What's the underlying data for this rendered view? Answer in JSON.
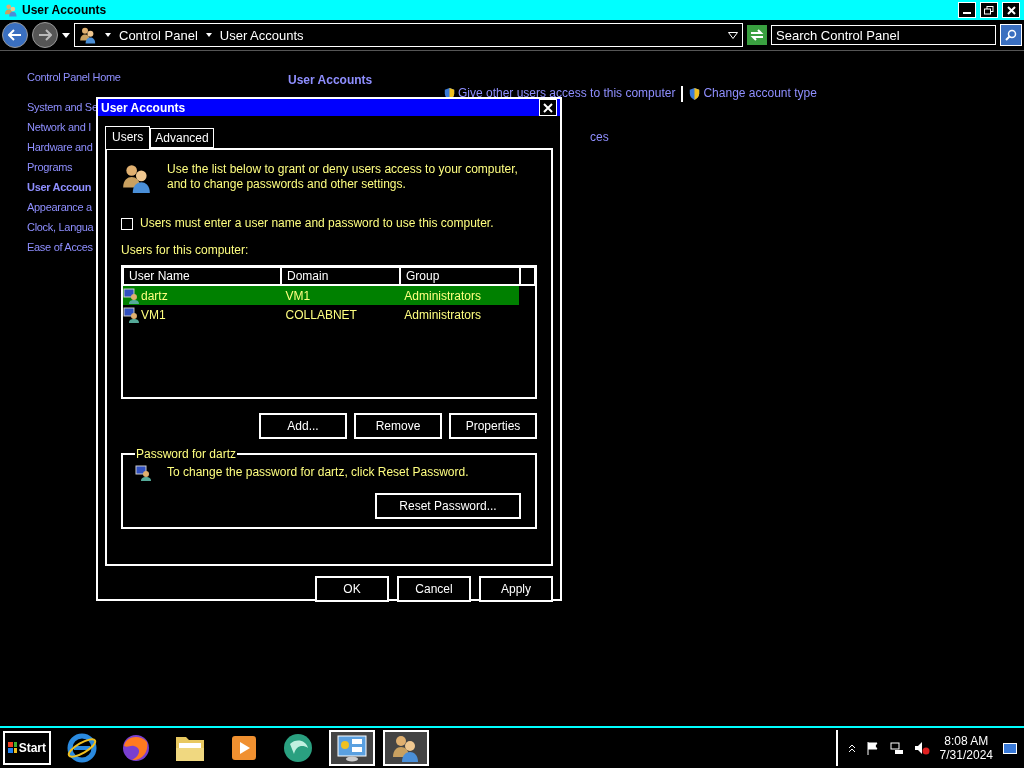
{
  "window": {
    "title": "User Accounts"
  },
  "address_bar": {
    "breadcrumbs": [
      "Control Panel",
      "User Accounts"
    ],
    "search": {
      "placeholder": "Search Control Panel"
    }
  },
  "sidebar": {
    "home": "Control Panel Home",
    "items": [
      {
        "label": "System and Se",
        "selected": false
      },
      {
        "label": "Network and I",
        "selected": false
      },
      {
        "label": "Hardware and",
        "selected": false
      },
      {
        "label": "Programs",
        "selected": false
      },
      {
        "label": "User Accoun",
        "selected": true
      },
      {
        "label": "Appearance a",
        "selected": false
      },
      {
        "label": "Clock, Langua",
        "selected": false
      },
      {
        "label": "Ease of Acces",
        "selected": false
      }
    ]
  },
  "content": {
    "heading": "User Accounts",
    "tasks": [
      {
        "label": "Give other users access to this computer"
      },
      {
        "label": "Change account type"
      }
    ],
    "fragment": "ces"
  },
  "dialog": {
    "title": "User Accounts",
    "tabs": [
      {
        "label": "Users",
        "selected": true
      },
      {
        "label": "Advanced",
        "selected": false
      }
    ],
    "intro": "Use the list below to grant or deny users access to your computer, and to change passwords and other settings.",
    "require_login": {
      "label": "Users must enter a user name and password to use this computer.",
      "checked": false
    },
    "list_label": "Users for this computer:",
    "columns": [
      "User Name",
      "Domain",
      "Group"
    ],
    "rows": [
      {
        "user_name": "dartz",
        "domain": "VM1",
        "group": "Administrators",
        "selected": true
      },
      {
        "user_name": "VM1",
        "domain": "COLLABNET",
        "group": "Administrators",
        "selected": false
      }
    ],
    "list_buttons": [
      "Add...",
      "Remove",
      "Properties"
    ],
    "password_group": {
      "title": "Password for dartz",
      "text": "To change the password for dartz, click Reset Password.",
      "button": "Reset Password..."
    },
    "footer_buttons": [
      "OK",
      "Cancel",
      "Apply"
    ]
  },
  "taskbar": {
    "start": "Start",
    "apps": [
      {
        "kind": "browser",
        "selected": false
      },
      {
        "kind": "fox",
        "selected": false
      },
      {
        "kind": "folder",
        "selected": false
      },
      {
        "kind": "player",
        "selected": false
      },
      {
        "kind": "globe",
        "selected": false
      },
      {
        "kind": "panel",
        "selected": true
      },
      {
        "kind": "users",
        "selected": true
      }
    ],
    "time": "8:08 AM",
    "date": "7/31/2024"
  }
}
